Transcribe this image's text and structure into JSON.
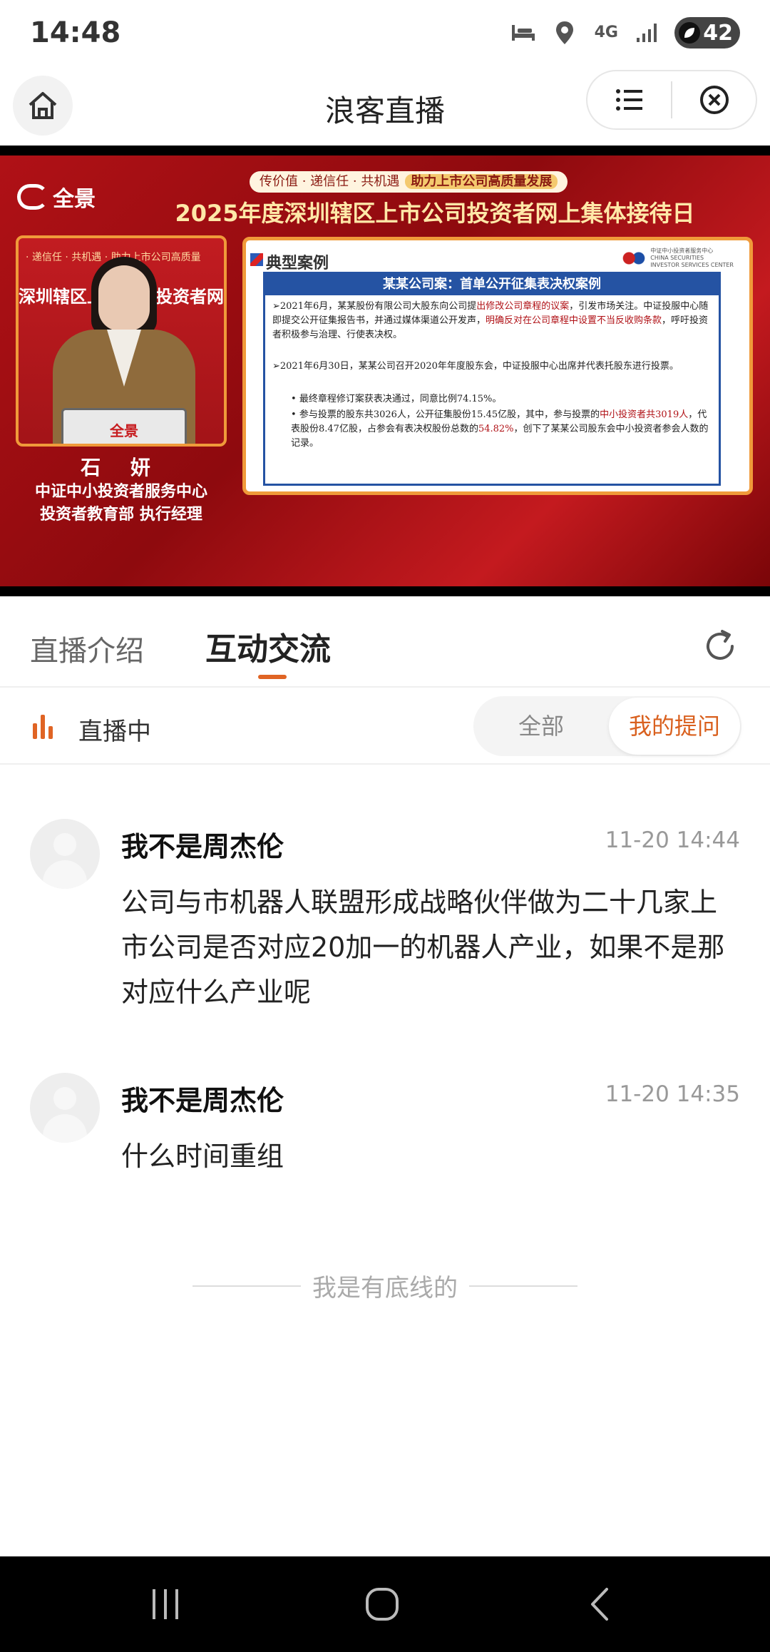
{
  "status_bar": {
    "time": "14:48",
    "network_type": "4G",
    "battery_level": "42",
    "icons": [
      "bed-icon",
      "location-icon",
      "network-4g-icon",
      "signal-icon",
      "battery-icon"
    ]
  },
  "title_bar": {
    "title": "浪客直播",
    "home_icon": "home-icon",
    "menu_icon": "list-menu-icon",
    "close_icon": "close-circle-icon"
  },
  "video": {
    "brand": "全景",
    "slogan": "传价值 · 递信任 · 共机遇",
    "slogan_highlight": "助力上市公司高质量发展",
    "heading": "2025年度深圳辖区上市公司投资者网上集体接待日",
    "backdrop_text": "深圳辖区上市公司投资者网上",
    "backdrop_small": "· 递信任 · 共机遇 · 助力上市公司高质量",
    "podium_brand": "全景",
    "speaker_name": "石 妍",
    "speaker_org_line1": "中证中小投资者服务中心",
    "speaker_org_line2": "投资者教育部 执行经理",
    "slide": {
      "label": "典型案例",
      "logo_text_cn": "中证中小投资者服务中心",
      "logo_text_en1": "CHINA SECURITIES",
      "logo_text_en2": "INVESTOR SERVICES CENTER",
      "box_title": "某某公司案：首单公开征集表决权案例",
      "p1_a": "➢2021年6月，某某股份有限公司大股东向公司提",
      "p1_hl1": "出修改公司章程的议案",
      "p1_b": "，引发市场关注。中证投服中心随即提交公开征集报告书，并通过媒体渠道公开发声，",
      "p1_hl2": "明确反对在公司章程中设置不当反收购条款",
      "p1_c": "，呼吁投资者积极参与治理、行使表决权。",
      "p2": "➢2021年6月30日，某某公司召开2020年年度股东会，中证投服中心出席并代表托股东进行投票。",
      "b1": "最终章程修订案获表决通过，同意比例74.15%。",
      "b2_a": "参与投票的股东共3026人，公开征集股份15.45亿股，其中，参与投票的",
      "b2_hl1": "中小投资者共3019人",
      "b2_b": "，代表股份8.47亿股，占参会有表决权股份总数的",
      "b2_hl2": "54.82%",
      "b2_c": "，创下了某某公司股东会中小投资者参会人数的记录。"
    }
  },
  "tabs": {
    "intro": "直播介绍",
    "interact": "互动交流",
    "refresh_icon": "refresh-icon"
  },
  "live_row": {
    "status": "直播中",
    "filter_all": "全部",
    "filter_mine": "我的提问",
    "accent_color": "#e06424"
  },
  "messages": [
    {
      "user": "我不是周杰伦",
      "time": "11-20 14:44",
      "text": "公司与市机器人联盟形成战略伙伴做为二十几家上市公司是否对应20加一的机器人产业，如果不是那对应什么产业呢"
    },
    {
      "user": "我不是周杰伦",
      "time": "11-20 14:35",
      "text": "什么时间重组"
    }
  ],
  "end_text": "我是有底线的",
  "nav_bar": {
    "recents_icon": "recents-icon",
    "home_icon": "home-circle-icon",
    "back_icon": "back-icon"
  }
}
